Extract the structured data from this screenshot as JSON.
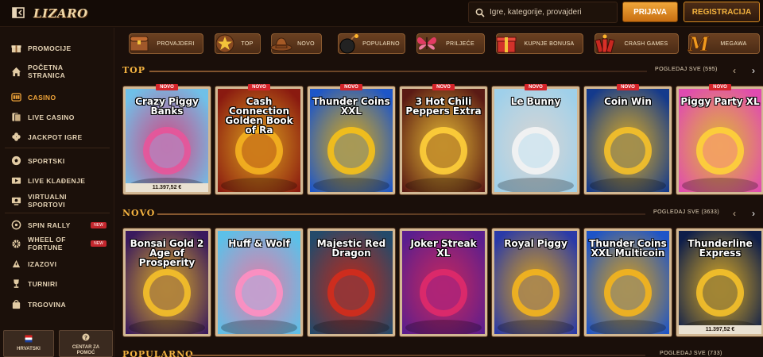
{
  "header": {
    "logo_text": "LIZARO",
    "search_placeholder": "Igre, kategorije, provajderi",
    "login_label": "PRIJAVA",
    "register_label": "REGISTRACIJA"
  },
  "sidebar": {
    "items": [
      {
        "label": "PROMOCIJE",
        "icon": "gift-icon"
      },
      {
        "label": "POČETNA STRANICA",
        "icon": "home-icon"
      },
      {
        "label": "CASINO",
        "icon": "casino-icon",
        "active": true
      },
      {
        "label": "LIVE CASINO",
        "icon": "cards-icon"
      },
      {
        "label": "JACKPOT IGRE",
        "icon": "clover-icon"
      },
      {
        "label": "SPORTSKI",
        "icon": "football-icon"
      },
      {
        "label": "LIVE KLAĐENJE",
        "icon": "live-tv-icon"
      },
      {
        "label": "VIRTUALNI SPORTOVI",
        "icon": "virtual-sports-icon"
      },
      {
        "label": "SPIN RALLY",
        "icon": "spin-icon",
        "badge": "NEW"
      },
      {
        "label": "WHEEL OF FORTUNE",
        "icon": "wheel-icon",
        "badge": "NEW"
      },
      {
        "label": "IZAZOVI",
        "icon": "challenge-icon"
      },
      {
        "label": "TURNIRI",
        "icon": "trophy-icon"
      },
      {
        "label": "TRGOVINA",
        "icon": "shop-bag-icon"
      }
    ],
    "language_label": "HRVATSKI",
    "help_label": "CENTAR ZA POMOĆ"
  },
  "categories": [
    {
      "label": "PROVAJDERI",
      "icon": "provider-chest-icon"
    },
    {
      "label": "TOP",
      "icon": "top-star-icon"
    },
    {
      "label": "NOVO",
      "icon": "cowboy-hat-icon"
    },
    {
      "label": "POPULARNO",
      "icon": "bomb-icon"
    },
    {
      "label": "PRILJEĆE",
      "icon": "butterfly-icon"
    },
    {
      "label": "KUPNJE BONUSA",
      "icon": "gift-box-icon"
    },
    {
      "label": "CRASH GAMES",
      "icon": "dynamite-icon"
    },
    {
      "label": "MEGAWA",
      "icon": "megaways-m-icon"
    }
  ],
  "sections": {
    "top": {
      "title": "TOP",
      "see_all": "POGLEDAJ SVE (595)",
      "games": [
        {
          "title": "Crazy Piggy Banks",
          "badge": "NOVO",
          "jackpot": "11.397,52 €",
          "bg": "#6fc0e8",
          "accent": "#e8559a"
        },
        {
          "title": "Cash Connection Golden Book of Ra",
          "badge": "NOVO",
          "bg": "#8a1a10",
          "accent": "#f5b320"
        },
        {
          "title": "Thunder Coins XXL",
          "badge": "NOVO",
          "bg": "#1d56c8",
          "accent": "#f6c11a"
        },
        {
          "title": "3 Hot Chili Peppers Extra",
          "badge": "NOVO",
          "bg": "#5a1a14",
          "accent": "#ffcf3a"
        },
        {
          "title": "Le Bunny",
          "badge": "NOVO",
          "bg": "#9fd0ea",
          "accent": "#f4f4f4"
        },
        {
          "title": "Coin Win",
          "badge": "NOVO",
          "bg": "#143a8c",
          "accent": "#f5c12a"
        },
        {
          "title": "Piggy Party XL",
          "badge": "NOVO",
          "bg": "#e04bb0",
          "accent": "#ffd23a"
        }
      ]
    },
    "novo": {
      "title": "NOVO",
      "see_all": "POGLEDAJ SVE (3633)",
      "games": [
        {
          "title": "Bonsai Gold 2 Age of Prosperity",
          "badge": "",
          "bg": "#3a1a5e",
          "accent": "#f5c02a"
        },
        {
          "title": "Huff & Wolf",
          "badge": "",
          "bg": "#5cc0e8",
          "accent": "#ff8fc2"
        },
        {
          "title": "Majestic Red Dragon",
          "badge": "",
          "bg": "#244a6a",
          "accent": "#d42c1c"
        },
        {
          "title": "Joker Streak XL",
          "badge": "",
          "bg": "#5a1e8e",
          "accent": "#e02a6a"
        },
        {
          "title": "Royal Piggy",
          "badge": "",
          "bg": "#2a3aa8",
          "accent": "#f4b51e"
        },
        {
          "title": "Thunder Coins XXL Multicoin",
          "badge": "",
          "bg": "#1d54c8",
          "accent": "#f4b51e"
        },
        {
          "title": "Thunderline Express",
          "badge": "",
          "jackpot": "11.397,52 €",
          "bg": "#0e1e4a",
          "accent": "#f5c12a"
        }
      ]
    },
    "popularno": {
      "title": "POPULARNO",
      "see_all": "POGLEDAJ SVE (733)"
    }
  }
}
